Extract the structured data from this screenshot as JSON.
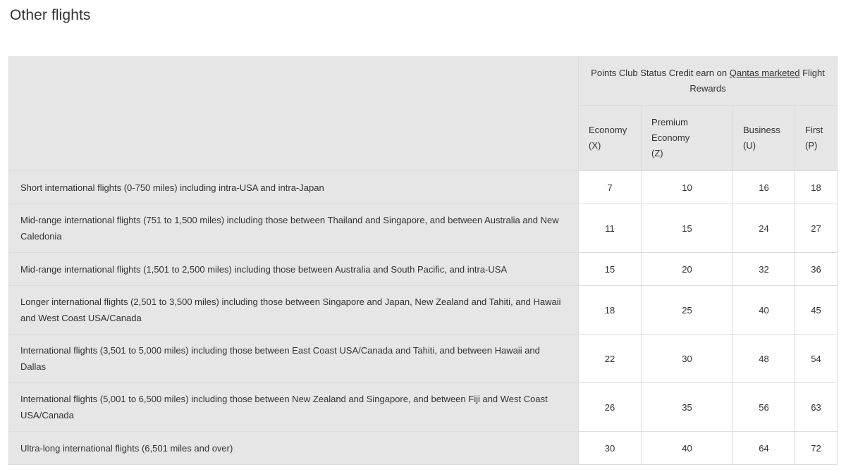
{
  "section_title": "Other flights",
  "table": {
    "group_header": {
      "prefix": "Points Club Status Credit earn on ",
      "link_text": "Qantas marketed",
      "suffix": " Flight Rewards"
    },
    "columns": [
      {
        "line1": "Economy",
        "line2": "(X)"
      },
      {
        "line1": "Premium Economy",
        "line2": "(Z)"
      },
      {
        "line1": "Business",
        "line2": "(U)"
      },
      {
        "line1": "First",
        "line2": "(P)"
      }
    ],
    "rows": [
      {
        "description": "Short international flights (0-750 miles) including intra-USA and intra-Japan",
        "values": [
          "7",
          "10",
          "16",
          "18"
        ]
      },
      {
        "description": "Mid-range international flights (751 to 1,500 miles) including those between Thailand and Singapore, and between Australia and New Caledonia",
        "values": [
          "11",
          "15",
          "24",
          "27"
        ]
      },
      {
        "description": "Mid-range international flights (1,501 to 2,500 miles) including those between Australia and South Pacific, and intra-USA",
        "values": [
          "15",
          "20",
          "32",
          "36"
        ]
      },
      {
        "description": "Longer international flights (2,501 to 3,500 miles) including those between Singapore and Japan, New Zealand and Tahiti, and Hawaii and West Coast USA/Canada",
        "values": [
          "18",
          "25",
          "40",
          "45"
        ]
      },
      {
        "description": "International flights (3,501 to 5,000 miles) including those between East Coast USA/Canada and Tahiti, and between Hawaii and Dallas",
        "values": [
          "22",
          "30",
          "48",
          "54"
        ]
      },
      {
        "description": "International flights (5,001 to 6,500 miles) including those between New Zealand and Singapore, and between Fiji and West Coast USA/Canada",
        "values": [
          "26",
          "35",
          "56",
          "63"
        ]
      },
      {
        "description": "Ultra-long international flights (6,501 miles and over)",
        "values": [
          "30",
          "40",
          "64",
          "72"
        ]
      }
    ]
  }
}
